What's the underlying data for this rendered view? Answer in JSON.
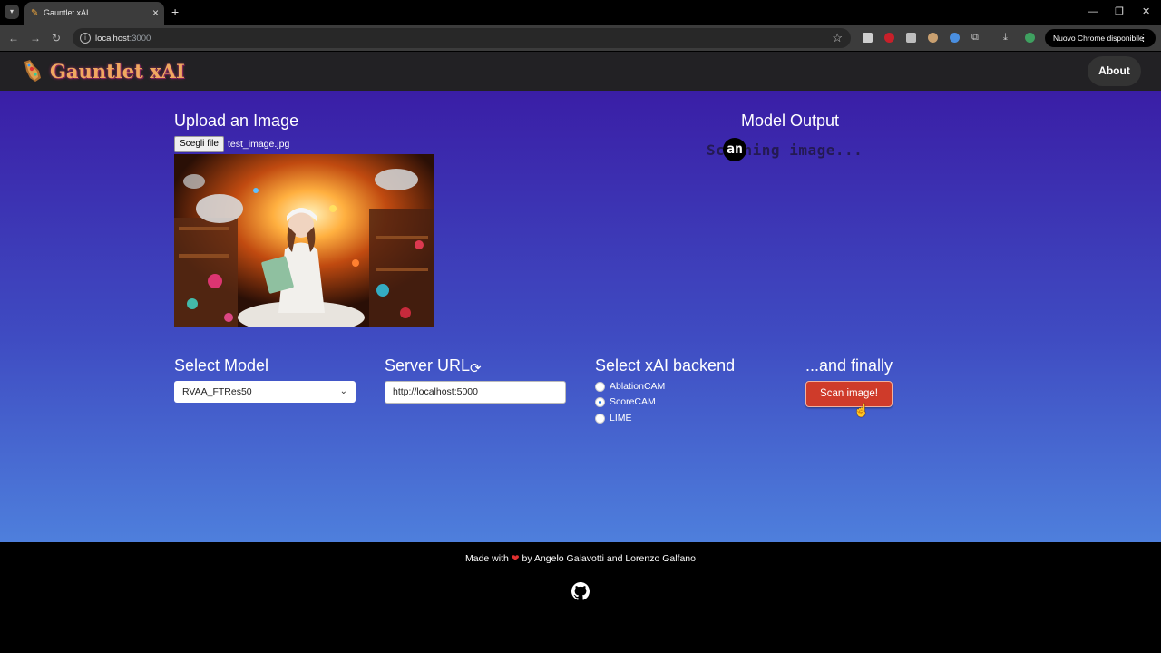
{
  "browser": {
    "tab_title": "Gauntlet xAI",
    "tab_list_icon": "chevron-down-icon",
    "new_tab_symbol": "+",
    "url_host": "localhost",
    "url_port": ":3000",
    "update_label": "Nuovo Chrome disponibile"
  },
  "app": {
    "brand_name": "Gauntlet xAI",
    "about_label": "About",
    "brand_color": "#f0a860"
  },
  "upload": {
    "title": "Upload an Image",
    "file_button": "Scegli file",
    "file_name": "test_image.jpg"
  },
  "output": {
    "title": "Model Output",
    "status": "Scanning image...",
    "spinner_chars": "an"
  },
  "model": {
    "title": "Select Model",
    "selected": "RVAA_FTRes50"
  },
  "server": {
    "title": "Server URL",
    "value": "http://localhost:5000"
  },
  "backend": {
    "title": "Select xAI backend",
    "options": [
      {
        "label": "AblationCAM",
        "checked": false
      },
      {
        "label": "ScoreCAM",
        "checked": true
      },
      {
        "label": "LIME",
        "checked": false
      }
    ]
  },
  "finally": {
    "title": "...and finally",
    "scan_label": "Scan image!",
    "scan_color": "#cf3b2a"
  },
  "footer": {
    "made_with": "Made with",
    "by_line": "by Angelo Galavotti and Lorenzo Galfano"
  }
}
